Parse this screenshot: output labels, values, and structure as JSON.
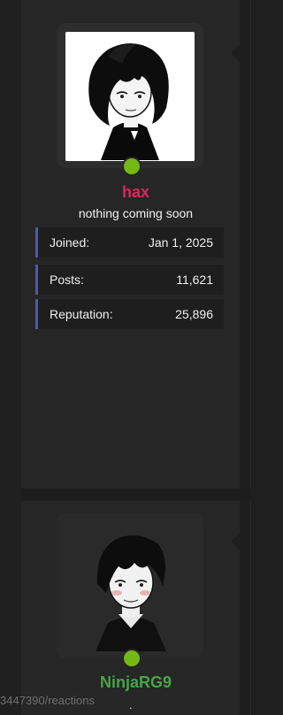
{
  "posts": [
    {
      "username": "hax",
      "user_title": "nothing coming soon",
      "online": true,
      "stats": [
        {
          "label": "Joined:",
          "value": "Jan 1, 2025"
        },
        {
          "label": "Posts:",
          "value": "11,621"
        },
        {
          "label": "Reputation:",
          "value": "25,896"
        }
      ]
    },
    {
      "username": "NinjaRG9",
      "online": true
    }
  ],
  "status_bar": {
    "url_fragment": "3447390/reactions",
    "suffix": "."
  },
  "colors": {
    "username_hax": "#e0245e",
    "username_ninjarg9": "#47a447",
    "online_dot": "#74b816",
    "stat_accent": "#4a5bab"
  }
}
